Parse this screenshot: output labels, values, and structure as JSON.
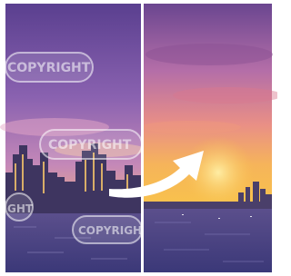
{
  "watermark": {
    "text": "COPYRIGHT",
    "left_partial": "GHT"
  },
  "colors": {
    "frame": "#ffffff",
    "divider": "#ffffff",
    "sky_top": "#5a3f8f",
    "sky_mid": "#b07ab8",
    "sunset": "#f3b24a",
    "water": "#433d7e",
    "arrow": "#ffffff"
  },
  "icons": [
    "before-after-comparison",
    "right-arrow-icon"
  ]
}
